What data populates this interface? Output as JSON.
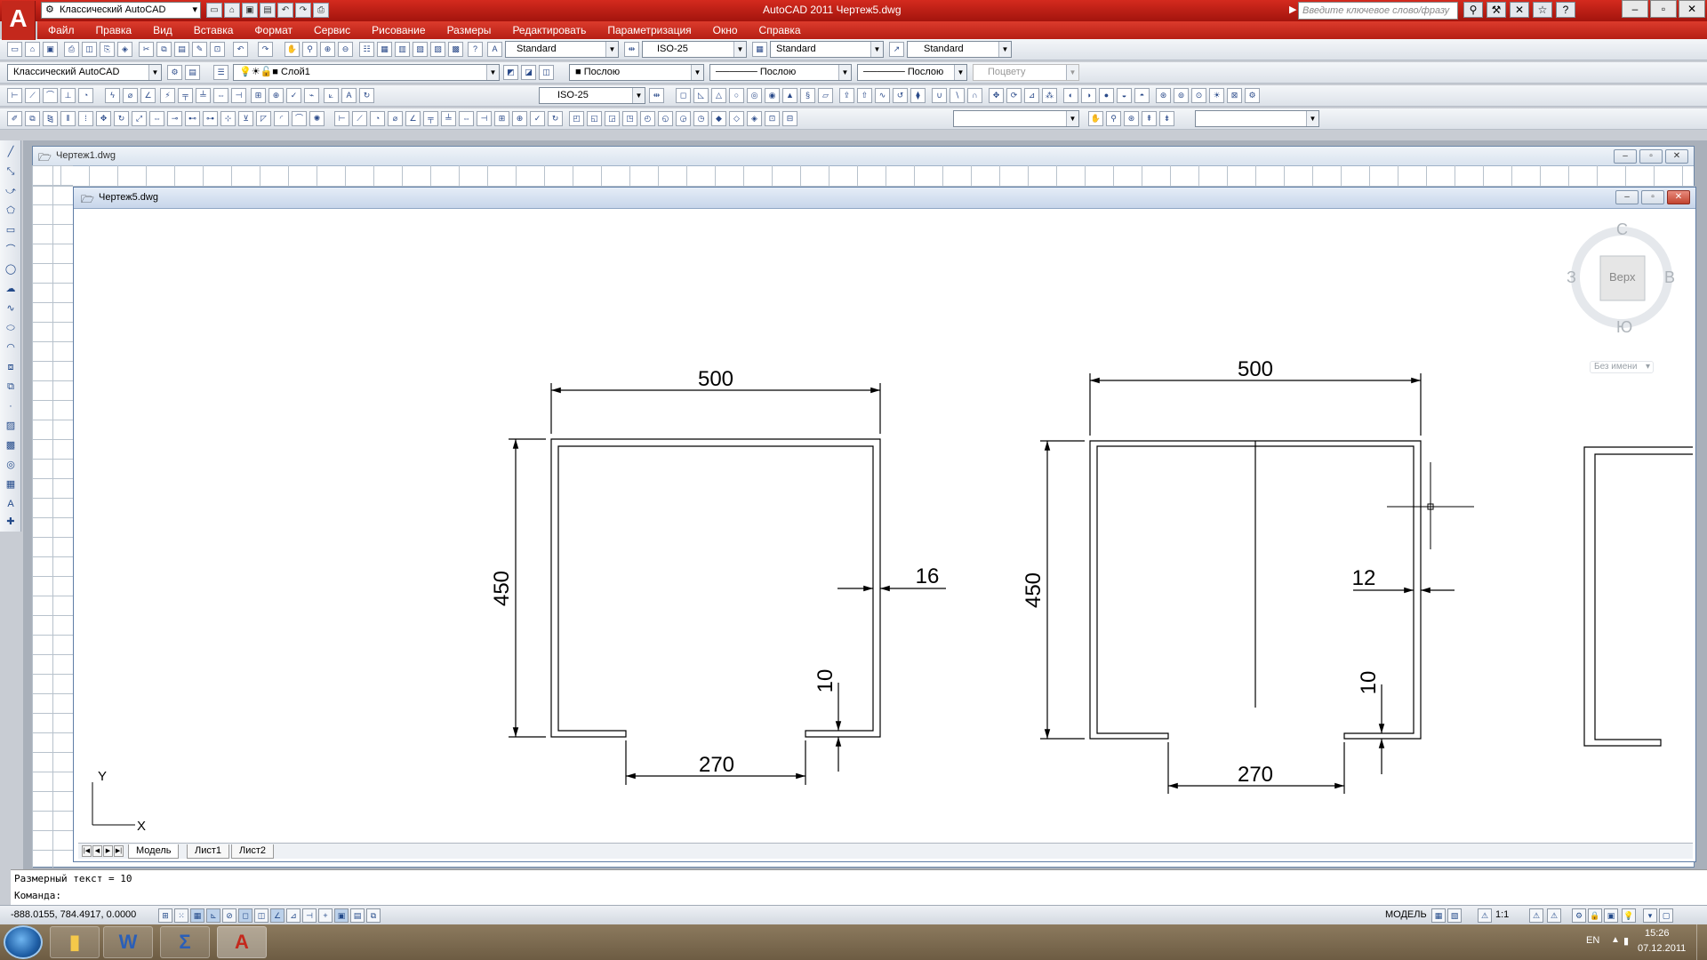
{
  "app": {
    "title": "AutoCAD 2011    Чертеж5.dwg",
    "workspace": "Классический AutoCAD",
    "search_placeholder": "Введите ключевое слово/фразу"
  },
  "menu": [
    "Файл",
    "Правка",
    "Вид",
    "Вставка",
    "Формат",
    "Сервис",
    "Рисование",
    "Размеры",
    "Редактировать",
    "Параметризация",
    "Окно",
    "Справка"
  ],
  "styles": {
    "text_style": "Standard",
    "dim_style": "ISO-25",
    "table_style": "Standard",
    "multileader_style": "Standard",
    "dim_style2": "ISO-25"
  },
  "layers": {
    "workspace": "Классический AutoCAD",
    "layer": "Слой1",
    "color": "Послою",
    "linetype": "Послою",
    "lineweight": "Послою",
    "plotstyle": "Поцвету"
  },
  "windows": {
    "back_doc": "Чертеж1.dwg",
    "front_doc": "Чертеж5.dwg"
  },
  "viewcube": {
    "north": "С",
    "south": "Ю",
    "east": "В",
    "west": "З",
    "face": "Верх",
    "ucs": "Без имени"
  },
  "drawing": {
    "left": {
      "width": "500",
      "height": "450",
      "wall": "16",
      "lip": "10",
      "opening": "270"
    },
    "right": {
      "width": "500",
      "height": "450",
      "wall": "12",
      "lip": "10",
      "opening": "270"
    },
    "ucs_y": "Y",
    "ucs_x": "X"
  },
  "tabs": [
    "Модель",
    "Лист1",
    "Лист2"
  ],
  "command": {
    "line1": "Размерный текст = 10",
    "line2": "Команда:"
  },
  "status": {
    "coords": "-888.0155, 784.4917, 0.0000",
    "model": "МОДЕЛЬ",
    "scale": "1:1"
  },
  "taskbar": {
    "lang": "EN",
    "time": "15:26",
    "date": "07.12.2011"
  },
  "colors": {
    "title_red": "#c4281c",
    "drawing_line": "#000000"
  }
}
